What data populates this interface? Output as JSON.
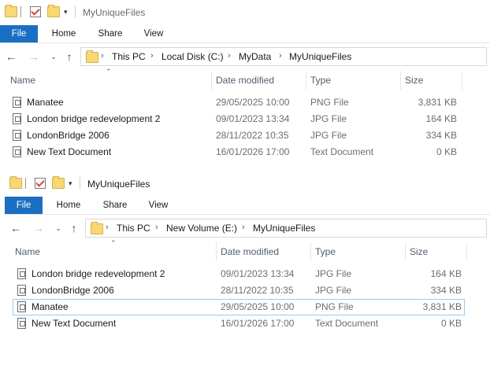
{
  "ribbon_tabs": [
    "File",
    "Home",
    "Share",
    "View"
  ],
  "columns": {
    "name": "Name",
    "date": "Date modified",
    "type": "Type",
    "size": "Size"
  },
  "windows": [
    {
      "title": "MyUniqueFiles",
      "breadcrumb": [
        "This PC",
        "Local Disk (C:)",
        "MyData",
        "MyUniqueFiles"
      ],
      "files": [
        {
          "name": "Manatee",
          "date": "29/05/2025 10:00",
          "type": "PNG File",
          "size": "3,831 KB"
        },
        {
          "name": "London bridge redevelopment 2",
          "date": "09/01/2023 13:34",
          "type": "JPG File",
          "size": "164 KB"
        },
        {
          "name": "LondonBridge 2006",
          "date": "28/11/2022 10:35",
          "type": "JPG File",
          "size": "334 KB"
        },
        {
          "name": "New Text Document",
          "date": "16/01/2026 17:00",
          "type": "Text Document",
          "size": "0 KB"
        }
      ]
    },
    {
      "title": "MyUniqueFiles",
      "breadcrumb": [
        "This PC",
        "New Volume (E:)",
        "MyUniqueFiles"
      ],
      "files": [
        {
          "name": "London bridge redevelopment 2",
          "date": "09/01/2023 13:34",
          "type": "JPG File",
          "size": "164 KB"
        },
        {
          "name": "LondonBridge 2006",
          "date": "28/11/2022 10:35",
          "type": "JPG File",
          "size": "334 KB"
        },
        {
          "name": "Manatee",
          "date": "29/05/2025 10:00",
          "type": "PNG File",
          "size": "3,831 KB",
          "selected": true
        },
        {
          "name": "New Text Document",
          "date": "16/01/2026 17:00",
          "type": "Text Document",
          "size": "0 KB"
        }
      ]
    }
  ],
  "icons": {
    "quick_access": [
      "folder-icon",
      "properties-check-icon",
      "new-folder-icon",
      "customize-dropdown-icon"
    ],
    "nav": [
      "back-arrow-icon",
      "forward-arrow-icon",
      "recent-locations-icon",
      "up-arrow-icon"
    ],
    "file": "file-icon"
  },
  "colors": {
    "file_tab": "#1a6fc2",
    "selection_border": "#99c9ef",
    "folder": "#f8d775"
  }
}
